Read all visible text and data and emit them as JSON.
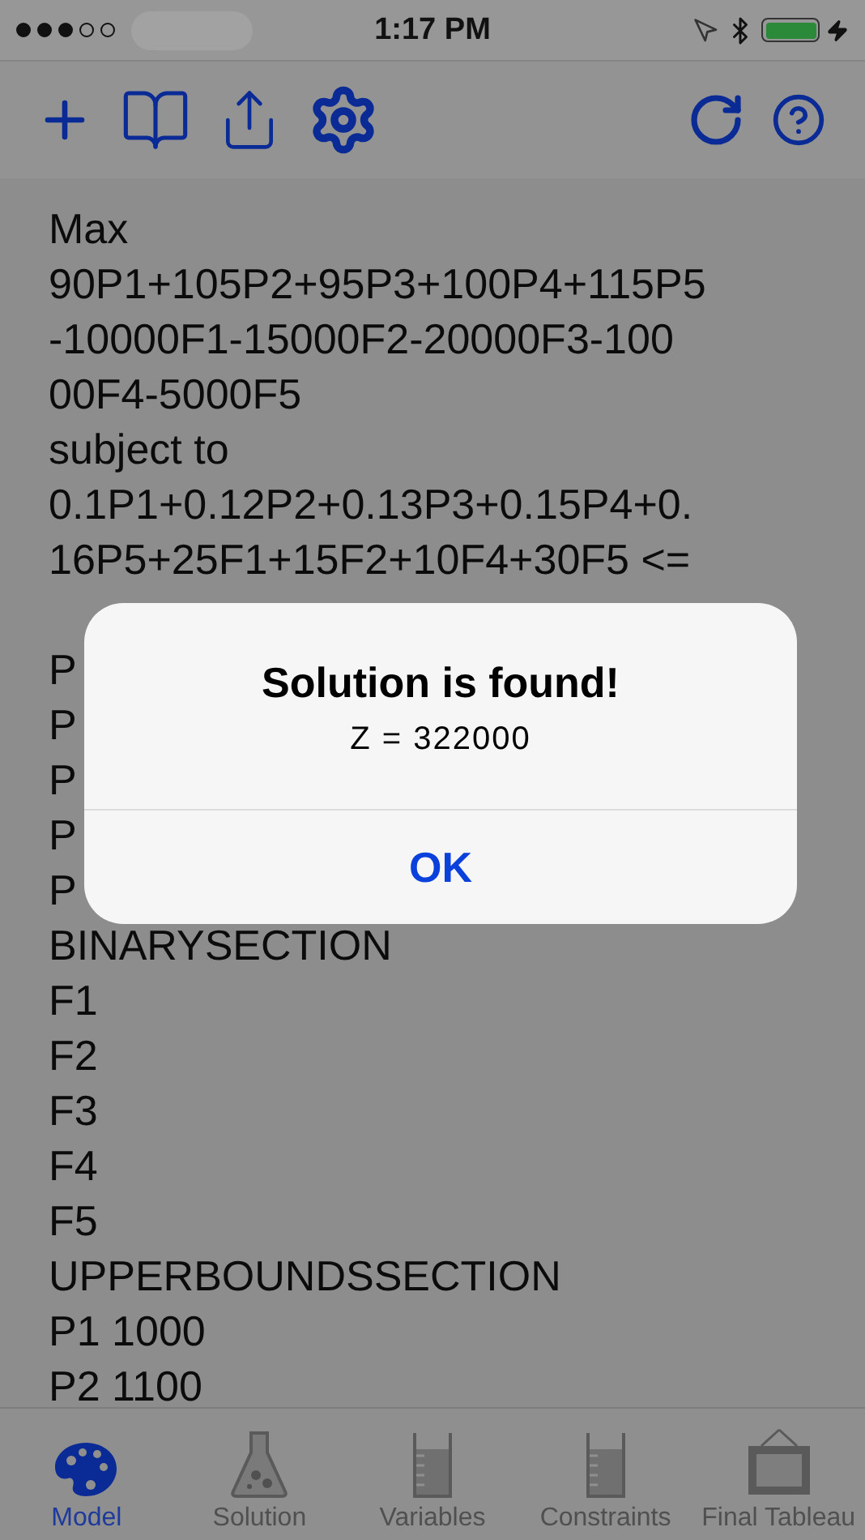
{
  "status_bar": {
    "time": "1:17 PM"
  },
  "model_text": [
    "Max",
    "90P1+105P2+95P3+100P4+115P5",
    "-10000F1-15000F2-20000F3-100",
    "00F4-5000F5",
    "subject to",
    "0.1P1+0.12P2+0.13P3+0.15P4+0.",
    "16P5+25F1+15F2+10F4+30F5 <=",
    "P",
    "P",
    "P",
    "P",
    "P",
    "BINARYSECTION",
    "F1",
    "F2",
    "F3",
    "F4",
    "F5",
    "UPPERBOUNDSSECTION",
    "P1 1000",
    "P2 1100"
  ],
  "alert": {
    "title": "Solution is found!",
    "message": "Z = 322000",
    "button": "OK"
  },
  "tabs": [
    {
      "label": "Model",
      "selected": true
    },
    {
      "label": "Solution",
      "selected": false
    },
    {
      "label": "Variables",
      "selected": false
    },
    {
      "label": "Constraints",
      "selected": false
    },
    {
      "label": "Final Tableau",
      "selected": false
    }
  ]
}
